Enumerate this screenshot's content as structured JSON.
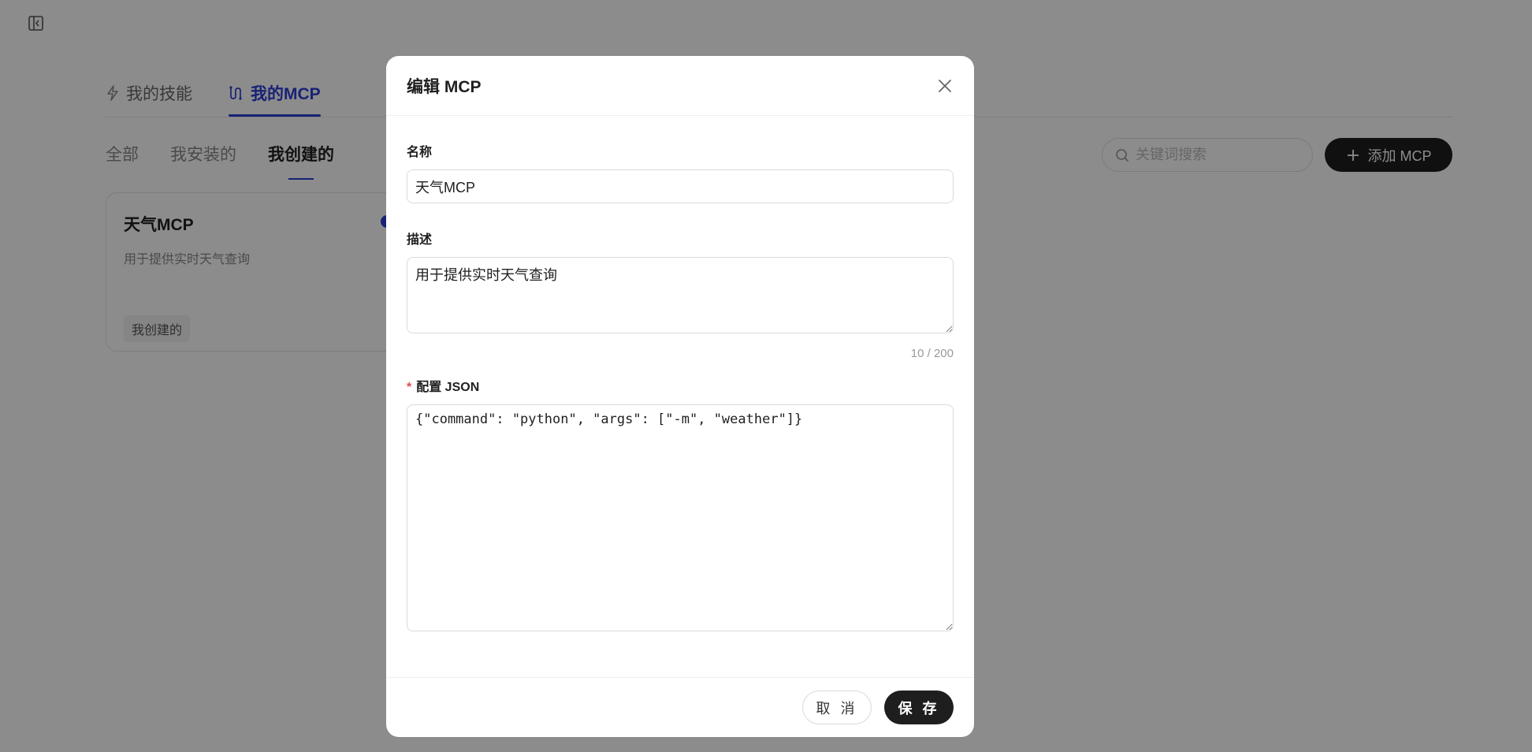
{
  "main_tabs": [
    {
      "label": "我的技能",
      "icon": "lightning-icon"
    },
    {
      "label": "我的MCP",
      "icon": "mcp-icon"
    }
  ],
  "sub_tabs": [
    "全部",
    "我安装的",
    "我创建的"
  ],
  "search": {
    "placeholder": "关键词搜索"
  },
  "add_button": {
    "label": "添加 MCP"
  },
  "card": {
    "title": "天气MCP",
    "description": "用于提供实时天气查询",
    "tag": "我创建的"
  },
  "modal": {
    "title": "编辑 MCP",
    "name_label": "名称",
    "name_value": "天气MCP",
    "desc_label": "描述",
    "desc_value": "用于提供实时天气查询",
    "desc_counter": "10 / 200",
    "json_required_mark": "*",
    "json_label": "配置 JSON",
    "json_value": "{\"command\": \"python\", \"args\": [\"-m\", \"weather\"]}",
    "cancel_label": "取 消",
    "save_label": "保 存"
  },
  "colors": {
    "accent": "#2b3fd6",
    "primary_button": "#1e1e1e",
    "required": "#e5484d"
  }
}
